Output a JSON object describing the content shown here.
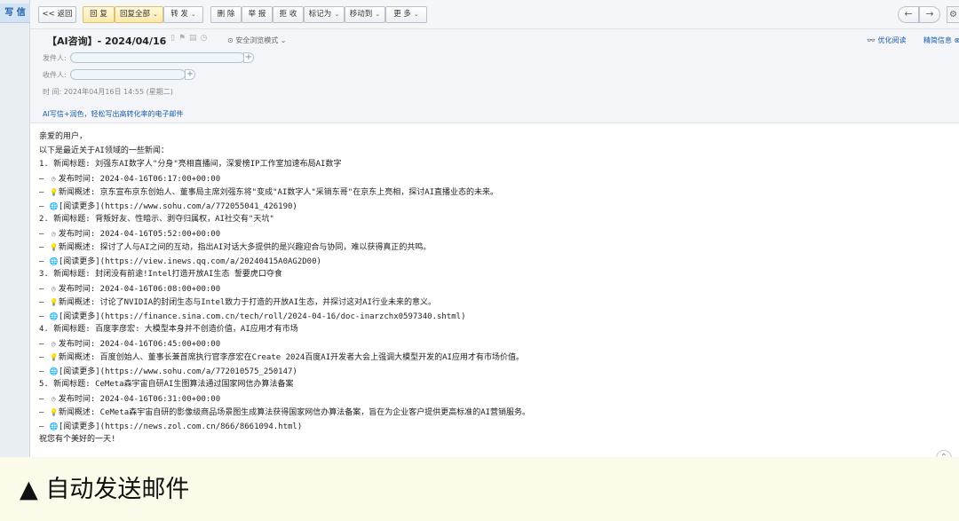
{
  "sidebar": {
    "compose_label": "写 信"
  },
  "toolbar": {
    "back": "<< 返回",
    "reply": "回 复",
    "reply_all": "回复全部",
    "forward": "转 发",
    "delete": "删 除",
    "report": "举 报",
    "reject": "拒 收",
    "mark_as": "标记为",
    "move_to": "移动到",
    "more": "更 多",
    "prev_icon": "←",
    "next_icon": "→",
    "settings_icon": "⚙"
  },
  "header": {
    "subject": "【AI咨询】- 2024/04/16",
    "browse_mode": "⊙ 安全浏览模式 ⌄",
    "optimize_read": "👓 优化阅读",
    "refine_info": "精简信息 ⊗",
    "sender_label": "发件人:",
    "recipient_label": "收件人:",
    "time_line": "时   间: 2024年04月16日 14:55 (星期二)",
    "ai_promo": "AI写信+润色，轻松写出高转化率的电子邮件"
  },
  "body_lines": [
    "亲爱的用户，",
    "以下是最近关于AI领域的一些新闻：",
    "1. 新闻标题: 刘强东AI数字人\"分身\"亮相直播间，深爱榜IP工作室加速布局AI数字",
    "发布时间: 2024-04-16T06:17:00+00:00",
    "新闻概述: 京东宣布京东创始人、董事局主席刘强东将\"变成\"AI数字人\"采销东哥\"在京东上亮相，探讨AI直播业态的未来。",
    "[阅读更多](https://www.sohu.com/a/772055041_426190)",
    "2. 新闻标题: 背叛好友、性暗示、剥夺归属权，AI社交有\"天坑\"",
    "发布时间: 2024-04-16T05:52:00+00:00",
    "新闻概述: 探讨了人与AI之间的互动，指出AI对话大多提供的是兴趣迎合与协同，难以获得真正的共鸣。",
    "[阅读更多](https://view.inews.qq.com/a/20240415A0AG2D00)",
    "3. 新闻标题: 封闭没有前途!Intel打造开放AI生态 誓要虎口夺食",
    "发布时间: 2024-04-16T06:08:00+00:00",
    "新闻概述: 讨论了NVIDIA的封闭生态与Intel致力于打造的开放AI生态，并探讨这对AI行业未来的意义。",
    "[阅读更多](https://finance.sina.com.cn/tech/roll/2024-04-16/doc-inarzchx0597340.shtml)",
    "4. 新闻标题: 百度李彦宏: 大模型本身并不创造价值，AI应用才有市场",
    "发布时间: 2024-04-16T06:45:00+00:00",
    "新闻概述: 百度创始人、董事长兼首席执行官李彦宏在Create 2024百度AI开发者大会上强调大模型开发的AI应用才有市场价值。",
    "[阅读更多](https://www.sohu.com/a/772010575_250147)",
    "5. 新闻标题: CeMeta森宇宙自研AI生图算法通过国家网信办算法备案",
    "发布时间: 2024-04-16T06:31:00+00:00",
    "新闻概述: CeMeta森宇宙自研的影像级商品场景图生成算法获得国家网信办算法备案，旨在为企业客户提供更高标准的AI营销服务。",
    "[阅读更多](https://news.zol.com.cn/866/8661094.html)",
    "祝您有个美好的一天!"
  ],
  "line_prefix": "— ",
  "icons": {
    "clock": "◷",
    "bulb": "💡",
    "globe": "🌐"
  },
  "banner": {
    "text": "▲ 自动发送邮件"
  },
  "scroll_icon": "⌃"
}
